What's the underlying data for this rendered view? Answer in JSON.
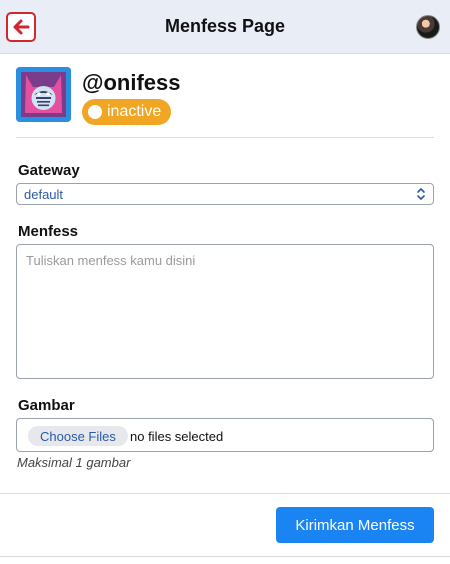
{
  "header": {
    "title": "Menfess Page",
    "back_icon": "arrow-left-icon",
    "accent": "#d0262e"
  },
  "profile": {
    "username": "@onifess",
    "status": "inactive",
    "status_color": "#f0a623"
  },
  "form": {
    "gateway_label": "Gateway",
    "gateway_value": "default",
    "menfess_label": "Menfess",
    "menfess_placeholder": "Tuliskan menfess kamu disini",
    "gambar_label": "Gambar",
    "choose_files_label": "Choose Files",
    "file_status": "no files selected",
    "help_text": "Maksimal 1 gambar",
    "submit_label": "Kirimkan Menfess",
    "submit_color": "#1a84f3"
  }
}
